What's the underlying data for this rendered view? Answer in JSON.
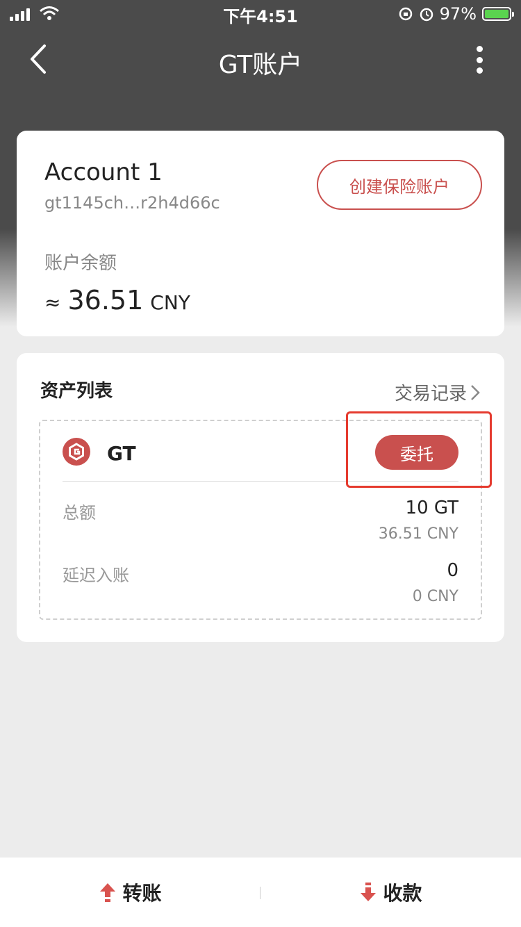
{
  "status": {
    "time": "下午4:51",
    "battery": "97%"
  },
  "nav": {
    "title": "GT账户"
  },
  "account": {
    "name": "Account 1",
    "address": "gt1145ch…r2h4d66c",
    "create_button": "创建保险账户",
    "balance_label": "账户余额",
    "balance_approx": "≈",
    "balance_value": "36.51",
    "balance_unit": "CNY"
  },
  "assets": {
    "title": "资产列表",
    "tx_link": "交易记录",
    "item": {
      "name": "GT",
      "delegate_button": "委托",
      "total_label": "总额",
      "total_value": "10 GT",
      "total_cny": "36.51 CNY",
      "pending_label": "延迟入账",
      "pending_value": "0",
      "pending_cny": "0 CNY"
    }
  },
  "bottom": {
    "transfer": "转账",
    "receive": "收款"
  },
  "colors": {
    "accent": "#c9504e",
    "header": "#4b4b4b",
    "highlight": "#e53b2f"
  }
}
